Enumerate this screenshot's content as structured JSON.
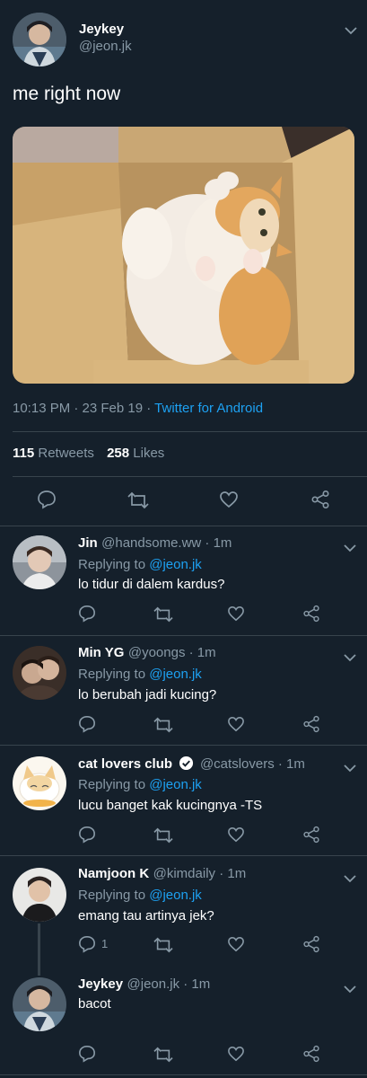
{
  "tweet": {
    "author_name": "Jeykey",
    "author_handle": "@jeon.jk",
    "text": "me right now",
    "time": "10:13 PM · 23 Feb 19 · ",
    "source": "Twitter for Android",
    "retweets_count": "115",
    "retweets_label": "Retweets",
    "likes_count": "258",
    "likes_label": "Likes"
  },
  "replies": [
    {
      "name": "Jin",
      "handle": "@handsome.ww · 1m",
      "replying_label": "Replying to ",
      "replying_to": "@jeon.jk",
      "text": "lo tidur di dalem kardus?"
    },
    {
      "name": "Min YG",
      "handle": "@yoongs · 1m",
      "replying_label": "Replying to ",
      "replying_to": "@jeon.jk",
      "text": "lo berubah jadi kucing?"
    },
    {
      "name": "cat lovers club",
      "handle": "@catslovers · 1m",
      "replying_label": "Replying to ",
      "replying_to": "@jeon.jk",
      "text": "lucu banget kak kucingnya -TS"
    },
    {
      "name": "Namjoon K",
      "handle": "@kimdaily · 1m",
      "replying_label": "Replying to ",
      "replying_to": "@jeon.jk",
      "text": "emang tau artinya jek?",
      "reply_count": "1"
    },
    {
      "name": "Jeykey",
      "handle": "@jeon.jk · 1m",
      "text": "bacot"
    }
  ],
  "colors": {
    "background": "#15202b",
    "accent": "#1da1f2",
    "muted": "#8899a6",
    "divider": "#38444d"
  }
}
